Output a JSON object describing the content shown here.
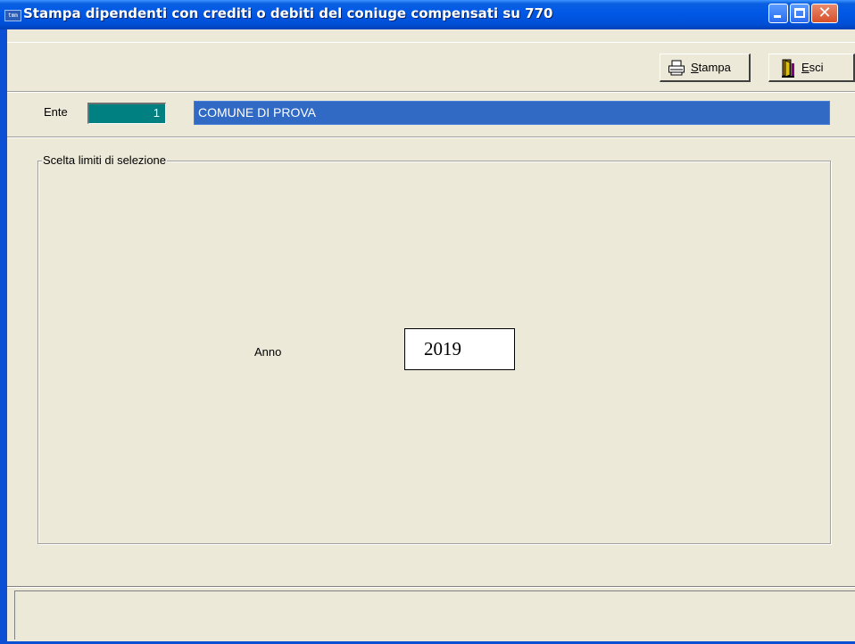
{
  "window": {
    "title": "Stampa dipendenti con crediti o debiti del coniuge compensati su 770",
    "app_icon_text": "ᵗᵐᵐ"
  },
  "toolbar": {
    "stampa_label": "Stampa",
    "stampa_accel": "S",
    "stampa_rest": "tampa",
    "esci_label": "Esci",
    "esci_accel": "E",
    "esci_rest": "sci"
  },
  "ente": {
    "label": "Ente",
    "code": "1",
    "name": "COMUNE DI PROVA"
  },
  "selection": {
    "group_title": "Scelta limiti di selezione",
    "anno_label": "Anno",
    "anno_value": "2019"
  },
  "colors": {
    "titlebar": "#0058e6",
    "window_bg": "#ece9d8",
    "ente_code_bg": "#008080",
    "ente_name_bg": "#316ac5"
  }
}
